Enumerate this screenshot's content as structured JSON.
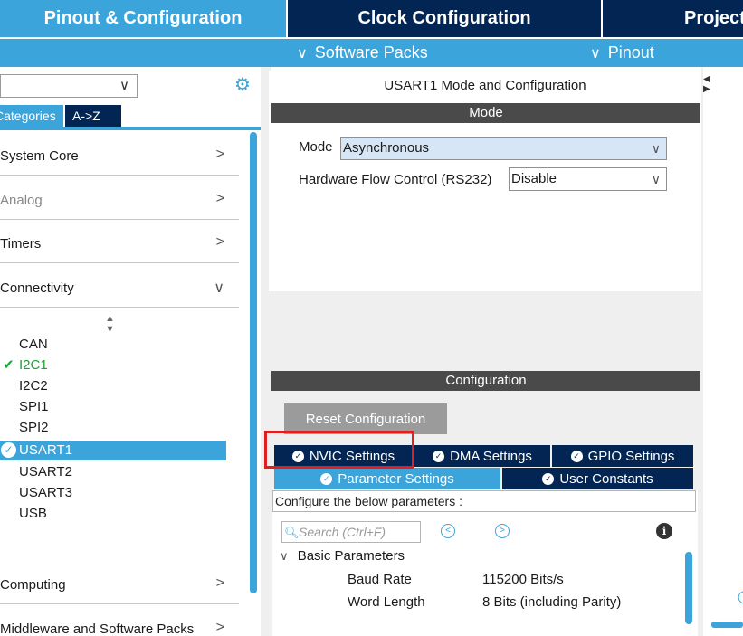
{
  "tabs": {
    "pinout": "Pinout & Configuration",
    "clock": "Clock Configuration",
    "project": "Project Manager"
  },
  "subbar": {
    "software_packs": "Software Packs",
    "pinout": "Pinout"
  },
  "left": {
    "tab_categories": "Categories",
    "tab_az": "A->Z",
    "categories": [
      {
        "label": "System Core"
      },
      {
        "label": "Analog"
      },
      {
        "label": "Timers"
      },
      {
        "label": "Connectivity"
      },
      {
        "label": "Computing"
      },
      {
        "label": "Middleware and Software Packs"
      }
    ],
    "peripherals": [
      "CAN",
      "I2C1",
      "I2C2",
      "SPI1",
      "SPI2",
      "USART1",
      "USART2",
      "USART3",
      "USB"
    ]
  },
  "center": {
    "mode_title": "USART1 Mode and Configuration",
    "mode_bar": "Mode",
    "mode_label": "Mode",
    "mode_value": "Asynchronous",
    "hw_label": "Hardware Flow Control (RS232)",
    "hw_value": "Disable",
    "config_bar": "Configuration",
    "reset_button": "Reset Configuration",
    "tabs": {
      "nvic": "NVIC Settings",
      "dma": "DMA Settings",
      "gpio": "GPIO Settings",
      "param": "Parameter Settings",
      "user": "User Constants"
    },
    "configure_text": "Configure the below parameters :",
    "search_placeholder": "Search (Ctrl+F)",
    "basic_params": "Basic Parameters",
    "params": [
      {
        "name": "Baud Rate",
        "value": "115200 Bits/s"
      },
      {
        "name": "Word Length",
        "value": "8 Bits (including Parity)"
      }
    ]
  },
  "colors": {
    "accent": "#3aa4db",
    "navy": "#022553",
    "enabled_green": "#1aa332",
    "highlight_red": "#e02020"
  },
  "icons": [
    "gear-icon",
    "chevron-down-icon",
    "chevron-right-icon",
    "check-icon",
    "sort-icon",
    "search-icon",
    "prev-icon",
    "next-icon",
    "info-icon"
  ]
}
